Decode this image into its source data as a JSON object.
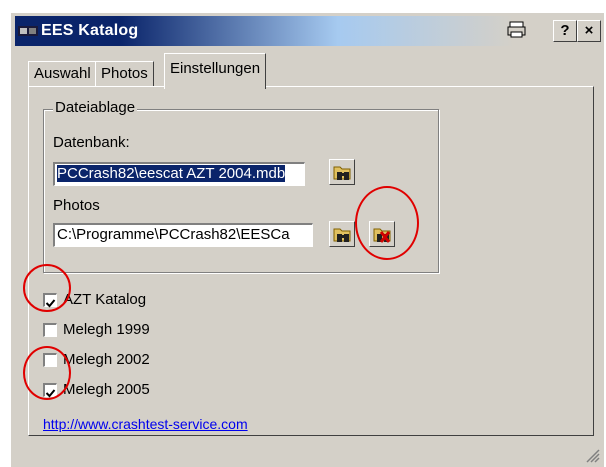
{
  "window": {
    "title": "EES Katalog",
    "help_label": "?",
    "close_label": "×"
  },
  "tabs": [
    {
      "label": "Auswahl"
    },
    {
      "label": "Photos"
    },
    {
      "label": "Einstellungen"
    }
  ],
  "group": {
    "title": "Dateiablage",
    "database_label": "Datenbank:",
    "database_value": "PCCrash82\\eescat AZT 2004.mdb",
    "photos_label": "Photos",
    "photos_value": "C:\\Programme\\PCCrash82\\EESCa"
  },
  "catalogs": [
    {
      "label": "AZT Katalog",
      "checked": true
    },
    {
      "label": "Melegh 1999",
      "checked": false
    },
    {
      "label": "Melegh 2002",
      "checked": false
    },
    {
      "label": "Melegh 2005",
      "checked": true
    }
  ],
  "link": {
    "text": "http://www.crashtest-service.com"
  },
  "colors": {
    "title_bar": "#0a246a",
    "face": "#d4d0c8",
    "annotation": "#e00000",
    "link": "#0000ee"
  },
  "icons": [
    "app-icon",
    "print-icon",
    "folder-binoculars-icon",
    "folder-delete-icon"
  ]
}
